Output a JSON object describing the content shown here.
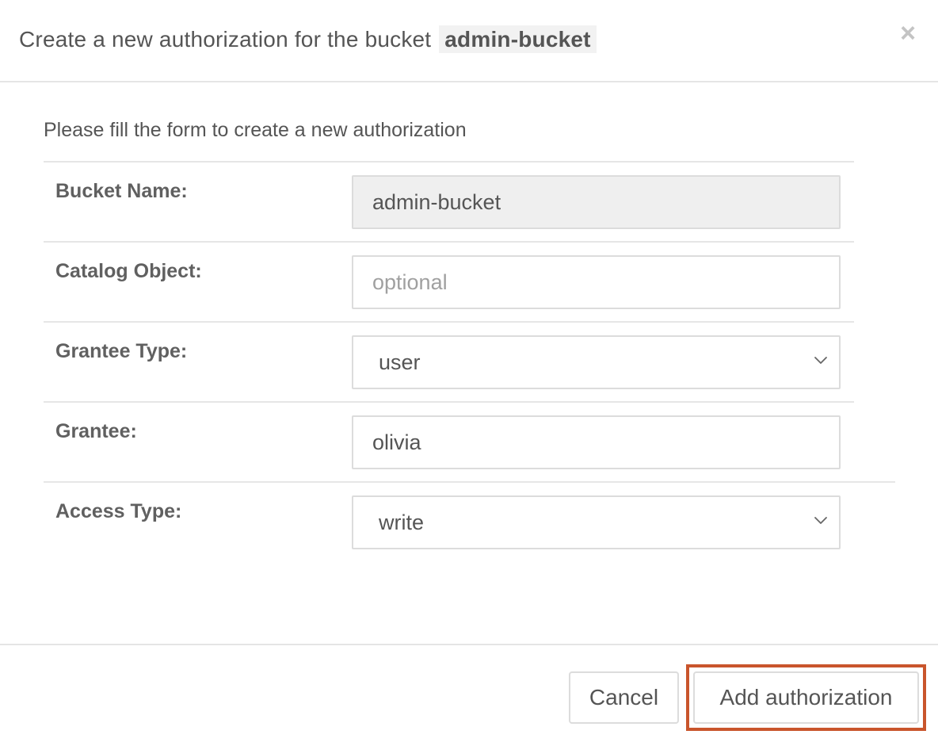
{
  "header": {
    "title_prefix": "Create a new authorization for the bucket",
    "bucket_name": "admin-bucket",
    "close_glyph": "×"
  },
  "form": {
    "intro": "Please fill the form to create a new authorization",
    "bucket_name": {
      "label": "Bucket Name:",
      "value": "admin-bucket"
    },
    "catalog_object": {
      "label": "Catalog Object:",
      "value": "",
      "placeholder": "optional"
    },
    "grantee_type": {
      "label": "Grantee Type:",
      "selected": "user"
    },
    "grantee": {
      "label": "Grantee:",
      "value": "olivia"
    },
    "access_type": {
      "label": "Access Type:",
      "selected": "write"
    }
  },
  "footer": {
    "cancel_label": "Cancel",
    "add_label": "Add authorization",
    "highlight_color": "#c9552c"
  },
  "icons": {
    "close": "close-icon",
    "dropdown": "chevron-down-icon"
  }
}
